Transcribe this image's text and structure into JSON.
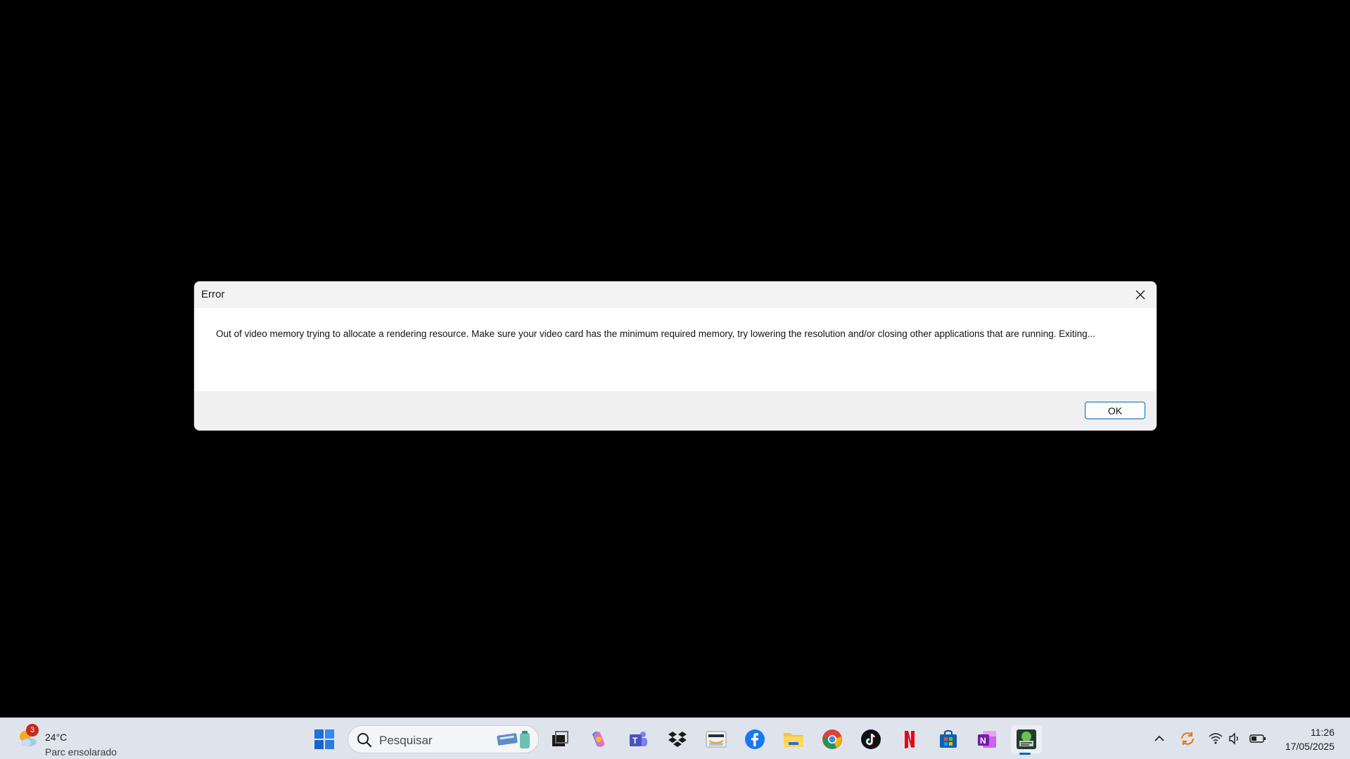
{
  "dialog": {
    "title": "Error",
    "message": "Out of video memory trying to allocate a rendering resource. Make sure your video card has the minimum required memory, try lowering the resolution and/or closing other applications that are running. Exiting...",
    "ok_label": "OK"
  },
  "taskbar": {
    "weather": {
      "temperature": "24°C",
      "condition": "Parc ensolarado",
      "badge": "3"
    },
    "search_placeholder": "Pesquisar",
    "apps": [
      "task-view",
      "copilot",
      "teams",
      "dropbox",
      "amazon",
      "facebook",
      "file-explorer",
      "chrome",
      "tiktok",
      "netflix",
      "microsoft-store",
      "onenote",
      "game"
    ],
    "clock": {
      "time": "11:26",
      "date": "17/05/2025"
    }
  },
  "colors": {
    "accent": "#0067c0",
    "taskbar_bg": "#dfe4ec",
    "desktop_bg": "#000000"
  }
}
